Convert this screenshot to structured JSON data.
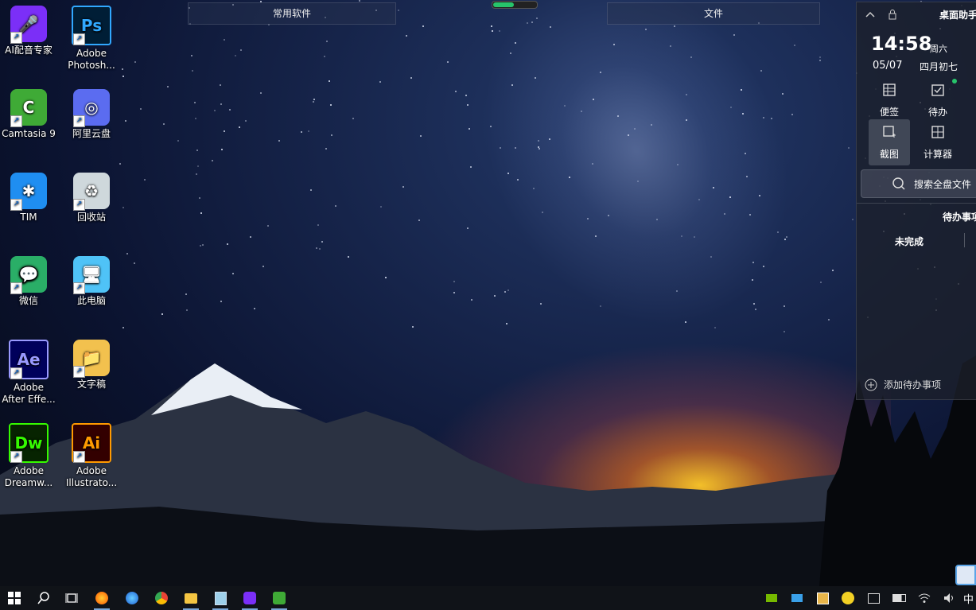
{
  "desktop": {
    "icons": [
      {
        "label1": "AI配音专家",
        "label2": "",
        "name": "ai-voice-expert-icon",
        "glyph": "🎤",
        "bg": "#7b2ff7"
      },
      {
        "label1": "Adobe",
        "label2": "Photosh...",
        "name": "adobe-photoshop-icon",
        "glyph": "Ps",
        "bg": "#001e36",
        "fg": "#31a8ff"
      },
      {
        "label1": "Camtasia 9",
        "label2": "",
        "name": "camtasia-icon",
        "glyph": "C",
        "bg": "#3faa36"
      },
      {
        "label1": "阿里云盘",
        "label2": "",
        "name": "aliyun-drive-icon",
        "glyph": "◎",
        "bg": "#5b6cf0"
      },
      {
        "label1": "TIM",
        "label2": "",
        "name": "tim-icon",
        "glyph": "✱",
        "bg": "#1f8ef1"
      },
      {
        "label1": "回收站",
        "label2": "",
        "name": "recycle-bin-icon",
        "glyph": "♻",
        "bg": "#cfd8dc"
      },
      {
        "label1": "微信",
        "label2": "",
        "name": "wechat-icon",
        "glyph": "💬",
        "bg": "#2aae67"
      },
      {
        "label1": "此电脑",
        "label2": "",
        "name": "this-pc-icon",
        "glyph": "🖥",
        "bg": "#4fc3f7"
      },
      {
        "label1": "Adobe",
        "label2": "After Effe...",
        "name": "adobe-after-effects-icon",
        "glyph": "Ae",
        "bg": "#00005b",
        "fg": "#9999ff"
      },
      {
        "label1": "文字稿",
        "label2": "",
        "name": "folder-wenzigao-icon",
        "glyph": "📁",
        "bg": "#f2c14e"
      },
      {
        "label1": "Adobe",
        "label2": "Dreamw...",
        "name": "adobe-dreamweaver-icon",
        "glyph": "Dw",
        "bg": "#072401",
        "fg": "#35fa00"
      },
      {
        "label1": "Adobe",
        "label2": "Illustrato...",
        "name": "adobe-illustrator-icon",
        "glyph": "Ai",
        "bg": "#330000",
        "fg": "#ff9a00"
      }
    ]
  },
  "fences": {
    "left_title": "常用软件",
    "right_title": "文件"
  },
  "panel": {
    "title": "桌面助手",
    "time": "14:58",
    "weekday": "周六",
    "date": "05/07",
    "lunar": "四月初七",
    "tools": [
      {
        "label": "便签",
        "icon": "note-icon"
      },
      {
        "label": "待办",
        "icon": "todo-icon"
      },
      {
        "label": "截图",
        "icon": "screenshot-icon"
      },
      {
        "label": "计算器",
        "icon": "calculator-icon"
      }
    ],
    "search_placeholder": "搜索全盘文件",
    "todo_title": "待办事项",
    "unfinished_tab": "未完成",
    "add_todo": "添加待办事项"
  },
  "taskbar": {
    "apps": [
      "windows-start-icon",
      "search-icon",
      "task-view-icon",
      "firefox-icon",
      "firefox-dev-icon",
      "chrome-icon",
      "file-explorer-icon",
      "notepad-icon",
      "ai-voice-icon",
      "camtasia-icon"
    ],
    "tray": [
      "nvidia-icon",
      "network-share-icon",
      "media-icon",
      "plus-circle-icon",
      "display-icon",
      "battery-icon",
      "wifi-icon",
      "volume-icon"
    ],
    "ime": "中"
  },
  "colors": {
    "accent": "#27c46b",
    "panel_bg": "#1c202a",
    "taskbar_bg": "#101318"
  }
}
